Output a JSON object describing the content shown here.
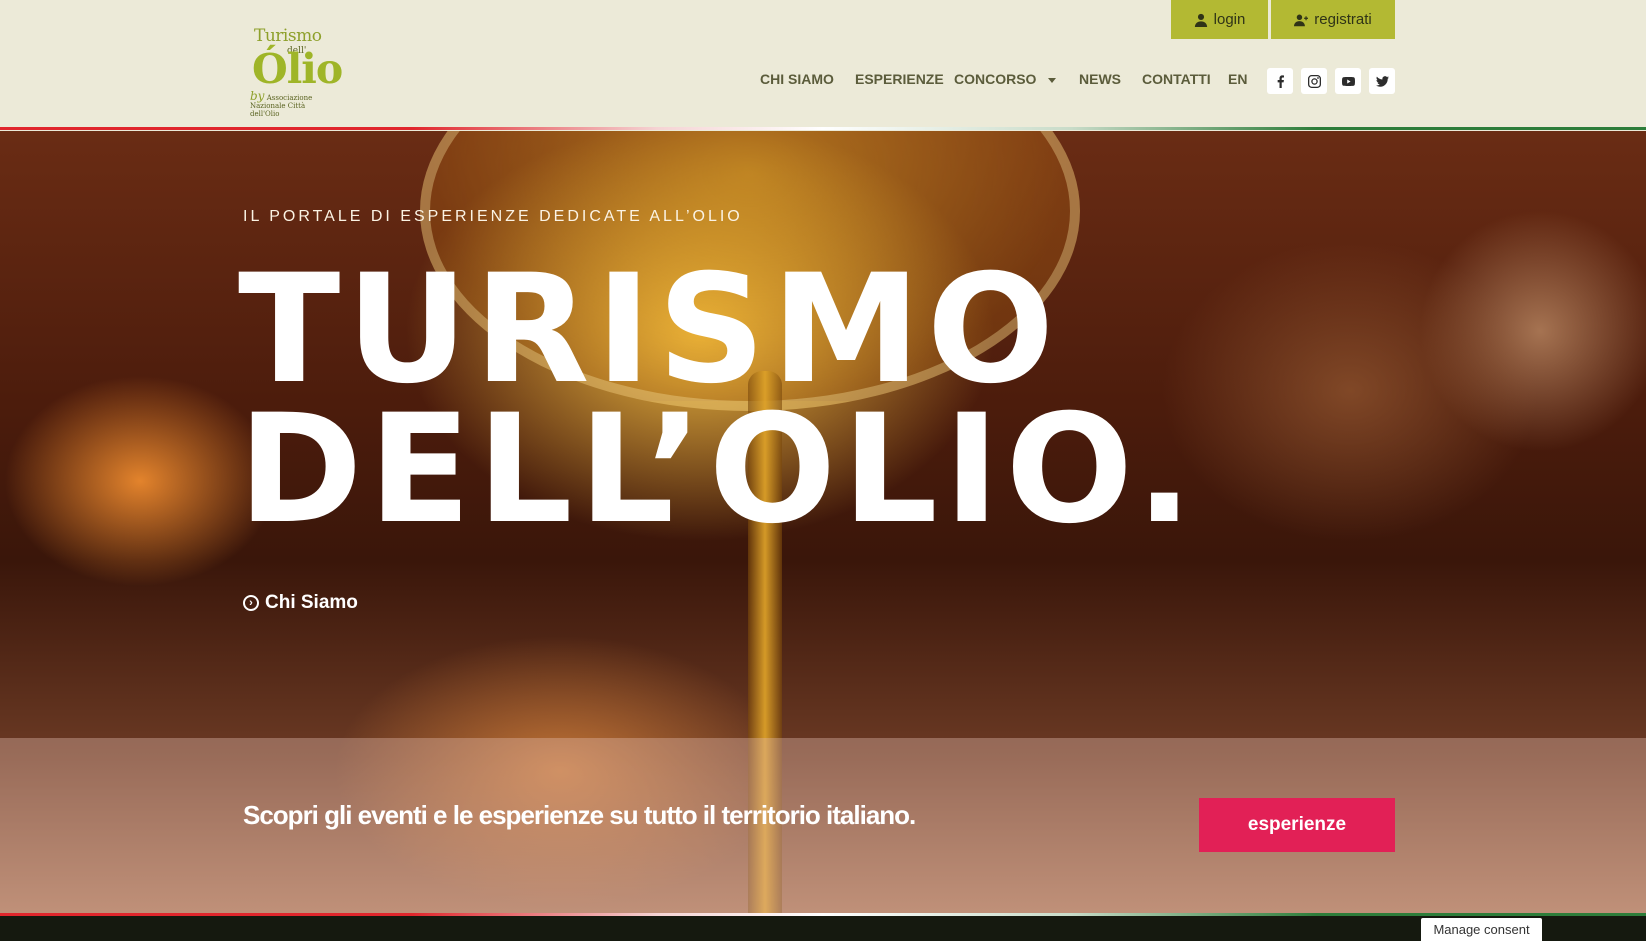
{
  "header": {
    "logo": {
      "line1": "Turismo",
      "line2": "dell'",
      "line3": "Ólio",
      "line4_prefix": "by",
      "line4": "Associazione Nazionale Città dell'Olio"
    },
    "top_buttons": {
      "login": "login",
      "register": "registrati"
    },
    "nav": {
      "chi_siamo": "CHI SIAMO",
      "esperienze": "ESPERIENZE",
      "concorso": "CONCORSO",
      "news": "NEWS",
      "contatti": "CONTATTI",
      "lang": "EN"
    },
    "social": [
      "facebook-icon",
      "instagram-icon",
      "youtube-icon",
      "twitter-icon"
    ]
  },
  "hero": {
    "eyebrow": "IL PORTALE DI ESPERIENZE DEDICATE ALL’OLIO",
    "title_line1": "TURISMO",
    "title_line2": "DELL’OLIO.",
    "link": "Chi Siamo"
  },
  "band": {
    "text": "Scopri gli eventi e le esperienze su tutto il territorio italiano.",
    "button": "esperienze"
  },
  "consent": "Manage consent",
  "colors": {
    "accent_olive": "#b3b933",
    "cta_pink": "#e22056",
    "bg_cream": "#ecead8",
    "footer_dark": "#15190f"
  }
}
